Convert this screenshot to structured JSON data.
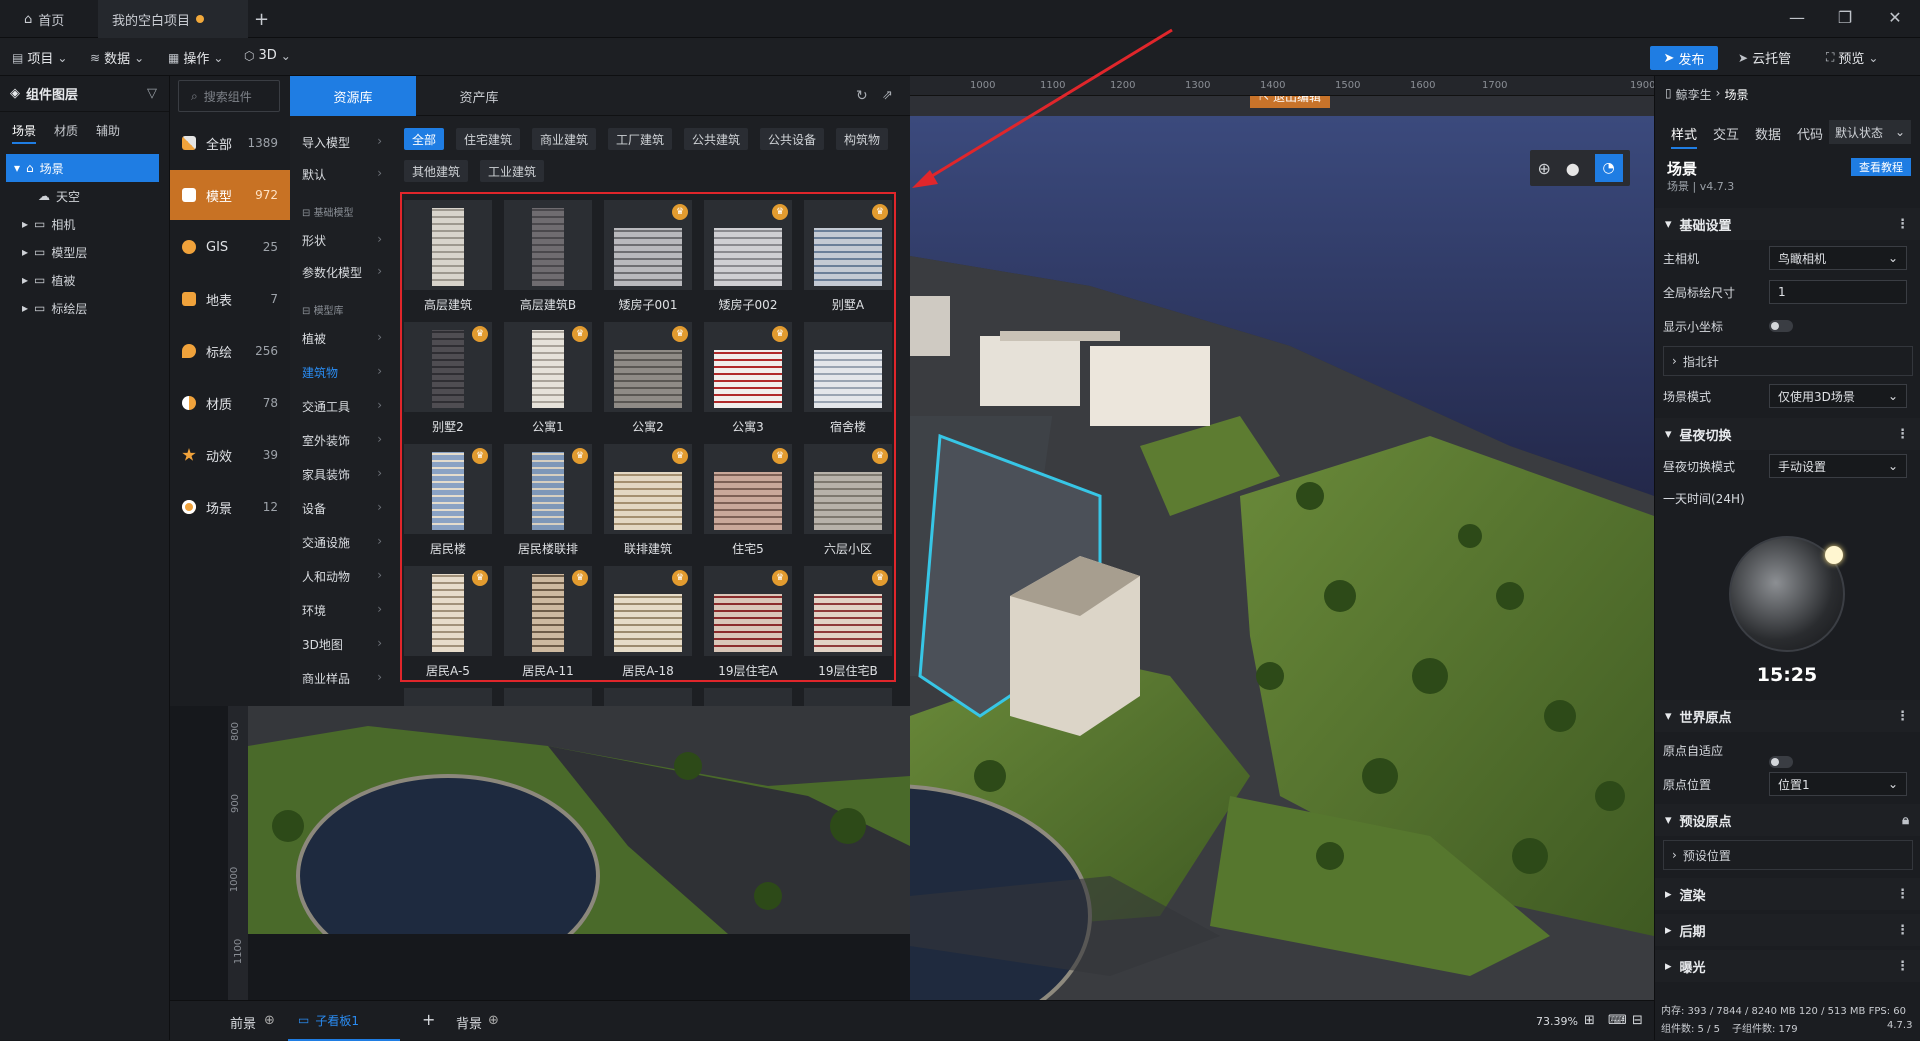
{
  "titlebar": {
    "home_label": "首页",
    "project_tab": "我的空白项目",
    "add_tab": "+"
  },
  "menubar": {
    "items": [
      {
        "label": "项目"
      },
      {
        "label": "数据"
      },
      {
        "label": "操作"
      },
      {
        "label": "3D"
      }
    ],
    "publish": "发布",
    "cloud": "云托管",
    "preview": "预览"
  },
  "layers": {
    "title": "组件图层",
    "tabs": [
      "场景",
      "材质",
      "辅助"
    ],
    "tree": [
      {
        "label": "场景",
        "selected": true
      },
      {
        "label": "天空"
      },
      {
        "label": "相机"
      },
      {
        "label": "模型层"
      },
      {
        "label": "植被"
      },
      {
        "label": "标绘层"
      }
    ]
  },
  "search": {
    "placeholder": "搜索组件"
  },
  "categories": [
    {
      "label": "全部",
      "count": "1389"
    },
    {
      "label": "模型",
      "count": "972"
    },
    {
      "label": "GIS",
      "count": "25"
    },
    {
      "label": "地表",
      "count": "7"
    },
    {
      "label": "标绘",
      "count": "256"
    },
    {
      "label": "材质",
      "count": "78"
    },
    {
      "label": "动效",
      "count": "39"
    },
    {
      "label": "场景",
      "count": "12"
    }
  ],
  "library": {
    "tab_active": "资源库",
    "tab_other": "资产库"
  },
  "subcats": {
    "top": [
      "导入模型",
      "默认"
    ],
    "head1": "基础模型",
    "group1": [
      "形状",
      "参数化模型"
    ],
    "head2": "模型库",
    "group2": [
      "植被",
      "建筑物",
      "交通工具",
      "室外装饰",
      "家具装饰",
      "设备",
      "交通设施",
      "人和动物",
      "环境",
      "3D地图",
      "商业样品"
    ]
  },
  "filters": [
    "全部",
    "住宅建筑",
    "商业建筑",
    "工厂建筑",
    "公共建筑",
    "公共设备",
    "构筑物",
    "其他建筑",
    "工业建筑"
  ],
  "models": [
    {
      "name": "高层建筑",
      "vip": false
    },
    {
      "name": "高层建筑B",
      "vip": false
    },
    {
      "name": "矮房子001",
      "vip": true
    },
    {
      "name": "矮房子002",
      "vip": true
    },
    {
      "name": "别墅A",
      "vip": true
    },
    {
      "name": "别墅2",
      "vip": true
    },
    {
      "name": "公寓1",
      "vip": true
    },
    {
      "name": "公寓2",
      "vip": true
    },
    {
      "name": "公寓3",
      "vip": true
    },
    {
      "name": "宿舍楼",
      "vip": false
    },
    {
      "name": "居民楼",
      "vip": true
    },
    {
      "name": "居民楼联排",
      "vip": true
    },
    {
      "name": "联排建筑",
      "vip": true
    },
    {
      "name": "住宅5",
      "vip": true
    },
    {
      "name": "六层小区",
      "vip": true
    },
    {
      "name": "居民A-5",
      "vip": true
    },
    {
      "name": "居民A-11",
      "vip": true
    },
    {
      "name": "居民A-18",
      "vip": true
    },
    {
      "name": "19层住宅A",
      "vip": true
    },
    {
      "name": "19层住宅B",
      "vip": true
    }
  ],
  "viewport": {
    "exit_edit": "退出编辑",
    "ruler_x": [
      "1000",
      "1100",
      "1200",
      "1300",
      "1400",
      "1500",
      "1600",
      "1700",
      "1900"
    ],
    "ruler_y": [
      "800",
      "900",
      "1000",
      "1100"
    ]
  },
  "right": {
    "breadcrumb_root": "鲸孪生",
    "breadcrumb_leaf": "场景",
    "tabs": [
      "样式",
      "交互",
      "数据",
      "代码"
    ],
    "state_select": "默认状态",
    "title": "场景",
    "subtitle": "场景 | v4.7.3",
    "tutorial": "查看教程",
    "sections": {
      "basic": "基础设置",
      "daynight": "昼夜切换",
      "origin": "世界原点",
      "preset_origin": "预设原点",
      "render": "渲染",
      "post": "后期",
      "exposure": "曝光"
    },
    "fields": {
      "main_camera_label": "主相机",
      "main_camera_value": "鸟瞰相机",
      "plot_size_label": "全局标绘尺寸",
      "plot_size_value": "1",
      "show_coord_label": "显示小坐标",
      "compass_label": "指北针",
      "scene_mode_label": "场景模式",
      "scene_mode_value": "仅使用3D场景",
      "daynight_mode_label": "昼夜切换模式",
      "daynight_mode_value": "手动设置",
      "day_time_label": "一天时间(24H)",
      "clock_time": "15:25",
      "origin_adapt_label": "原点自适应",
      "origin_pos_label": "原点位置",
      "origin_pos_value": "位置1",
      "preset_pos_label": "预设位置"
    },
    "status": {
      "memory": "内存: 393 / 7844 / 8240 MB  120 / 513 MB  FPS: 60",
      "components": "组件数: 5 / 5",
      "child_components": "子组件数: 179",
      "version": "4.7.3"
    }
  },
  "bottom": {
    "front": "前景",
    "child_board": "子看板1",
    "back": "背景",
    "zoom": "73.39%"
  }
}
